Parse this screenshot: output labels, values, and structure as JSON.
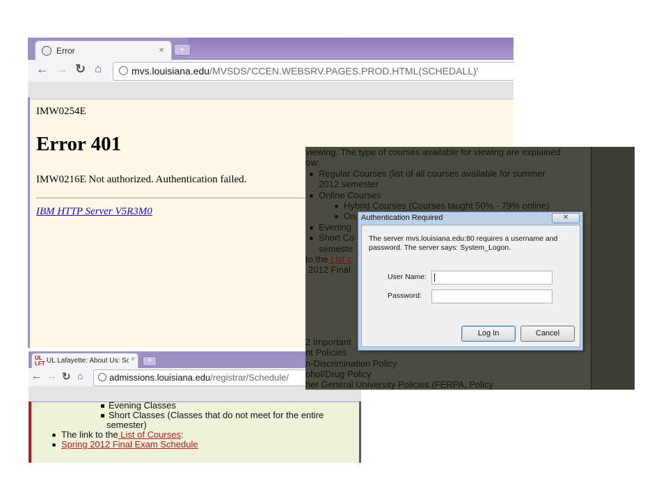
{
  "window1": {
    "tab_title": "Error",
    "tab_close": "×",
    "new_tab": "+",
    "url_host": "mvs.louisiana.edu",
    "url_path": "/MVSDS/'CCEN.WEBSRV.PAGES.PROD.HTML(SCHEDALL)'",
    "message_code": "IMW0254E",
    "heading": "Error 401",
    "message": "IMW0216E Not authorized. Authentication failed.",
    "server_link": "IBM HTTP Server V5R3M0"
  },
  "window2": {
    "tab_logo_top": "UL",
    "tab_logo_bottom": "LFT",
    "tab_title": "UL Lafayette: About Us: Sch",
    "tab_close": "×",
    "new_tab": "+",
    "url_host": "admissions.louisiana.edu",
    "url_path": "/registrar/Schedule/",
    "items": {
      "evening": "Evening Classes",
      "short_1": "Short Classes (Classes that do not meet for the entire",
      "short_2": "semester)",
      "link_prefix": "The link to the",
      "link_courses": " List of Courses",
      "link_suffix": ":",
      "final_exam": "Spring 2012 Final Exam Schedule"
    }
  },
  "window3": {
    "background_lines": {
      "l1": "viewing. The type of courses available for viewing are explained",
      "l2": "ow:",
      "l3": "Regular Courses (list of all courses available for summer",
      "l4": "2012 semester",
      "l5": "Online Courses",
      "l6": "Hybrid Courses (Courses taught 50% - 79% online)",
      "l7": "On",
      "l8": "Evening",
      "l9": "Short Co",
      "l10": "semeste",
      "l11a": "to the",
      "l11b": " List c",
      "l12": "2012 Final",
      "l13": "2 Important",
      "l14": "nt Policies",
      "l15": "n-Discrimination Policy",
      "l16": "ohol/Drug Policy",
      "l17": "her General University Policies (FERPA, Policy"
    },
    "dialog": {
      "title": "Authentication Required",
      "close": "✕",
      "message": "The server mvs.louisiana.edu:80 requires a username and password. The server says: System_Logon.",
      "username_label": "User Name:",
      "password_label": "Password:",
      "login_button": "Log In",
      "cancel_button": "Cancel"
    }
  }
}
